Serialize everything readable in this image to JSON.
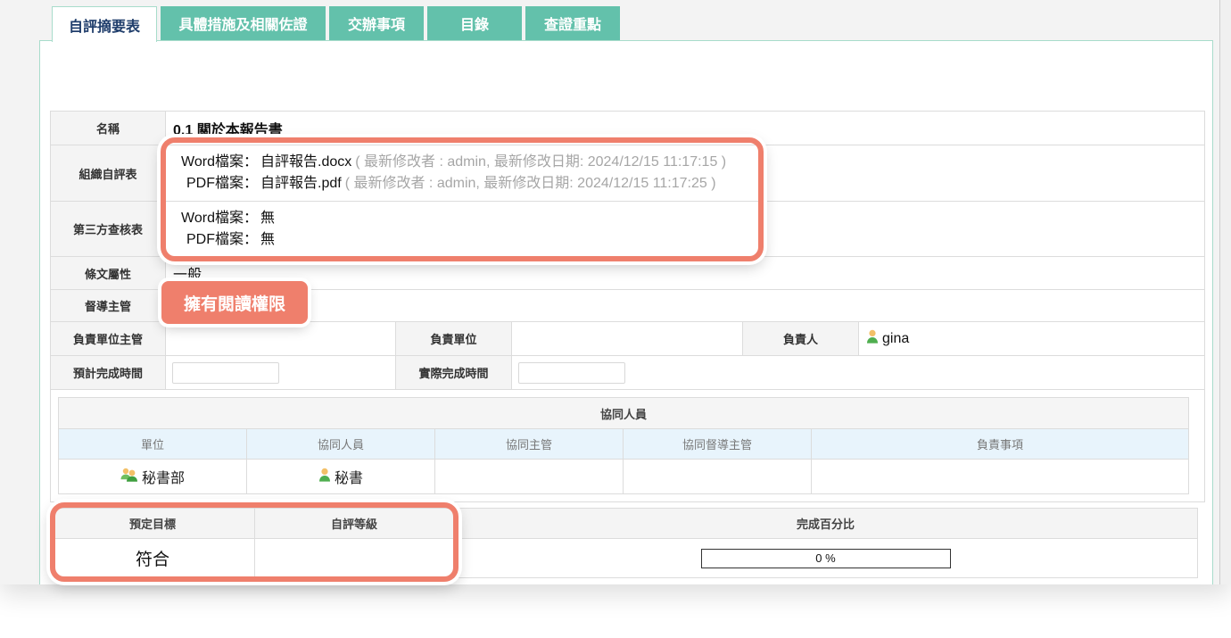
{
  "colors": {
    "tab_bg": "#63c1ab",
    "tab_active_text": "#1f3d6b",
    "panel_border": "#a8dccb",
    "highlight": "#ef7f6c",
    "header_blue": "#e8f4fc"
  },
  "icons": {
    "owner": "user-icon",
    "collab_unit": "group-icon",
    "collab_member": "user-icon"
  },
  "tabs": [
    {
      "label": "自評摘要表",
      "active": true
    },
    {
      "label": "具體措施及相關佐證",
      "active": false
    },
    {
      "label": "交辦事項",
      "active": false
    },
    {
      "label": "目錄",
      "active": false
    },
    {
      "label": "查證重點",
      "active": false
    }
  ],
  "summary": {
    "name_label": "名稱",
    "name_value": "0.1 關於本報告書",
    "org_self_eval": {
      "label": "組織自評表",
      "word_label": "Word檔案：",
      "word_file": "自評報告.docx",
      "word_meta": "( 最新修改者 : admin, 最新修改日期: 2024/12/15 11:17:15 )",
      "pdf_label": "PDF檔案：",
      "pdf_file": "自評報告.pdf",
      "pdf_meta": "( 最新修改者 : admin, 最新修改日期: 2024/12/15 11:17:25 )"
    },
    "third_party": {
      "label": "第三方查核表",
      "word_label": "Word檔案：",
      "word_file": "無",
      "pdf_label": "PDF檔案：",
      "pdf_file": "無"
    },
    "article_attr_label": "條文屬性",
    "article_attr_value": "一般",
    "supervisor_label": "督導主管",
    "unit_head_label": "負責單位主管",
    "unit_label": "負責單位",
    "owner_label": "負責人",
    "owner_value": "gina",
    "planned_label": "預計完成時間",
    "actual_label": "實際完成時間"
  },
  "collaborators": {
    "title": "協同人員",
    "columns": [
      "單位",
      "協同人員",
      "協同主管",
      "協同督導主管",
      "負責事項"
    ],
    "rows": [
      {
        "unit": "秘書部",
        "member": "秘書"
      }
    ]
  },
  "goals": {
    "columns": [
      "預定目標",
      "自評等級",
      "完成百分比"
    ],
    "target": "符合",
    "progress": 0,
    "progress_text": "0 %"
  },
  "annotations": {
    "permission_badge": "擁有閱讀權限"
  }
}
